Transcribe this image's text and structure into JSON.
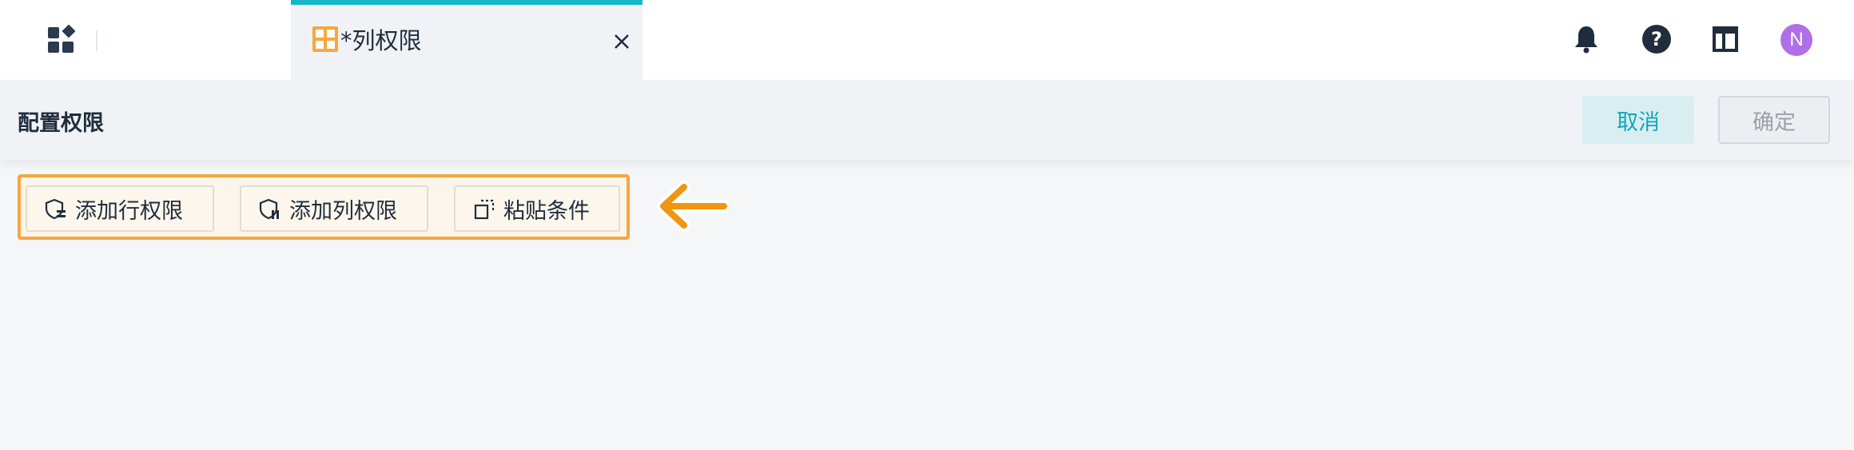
{
  "topbar": {
    "tab": {
      "label": "*列权限"
    },
    "icons": [
      "apps-icon",
      "tab-close-icon",
      "bell-icon",
      "help-icon",
      "layout-icon"
    ],
    "avatar": {
      "initial": "N",
      "color": "#b06fe8"
    }
  },
  "header": {
    "title": "配置权限",
    "cancel_label": "取消",
    "ok_label": "确定"
  },
  "toolbar": {
    "items": [
      {
        "label": "添加行权限",
        "icon": "row-permission-icon"
      },
      {
        "label": "添加列权限",
        "icon": "column-permission-icon"
      },
      {
        "label": "粘贴条件",
        "icon": "paste-icon"
      }
    ]
  },
  "colors": {
    "accent": "#13b5c7",
    "highlight": "#f5a83f",
    "avatar": "#b06fe8"
  }
}
